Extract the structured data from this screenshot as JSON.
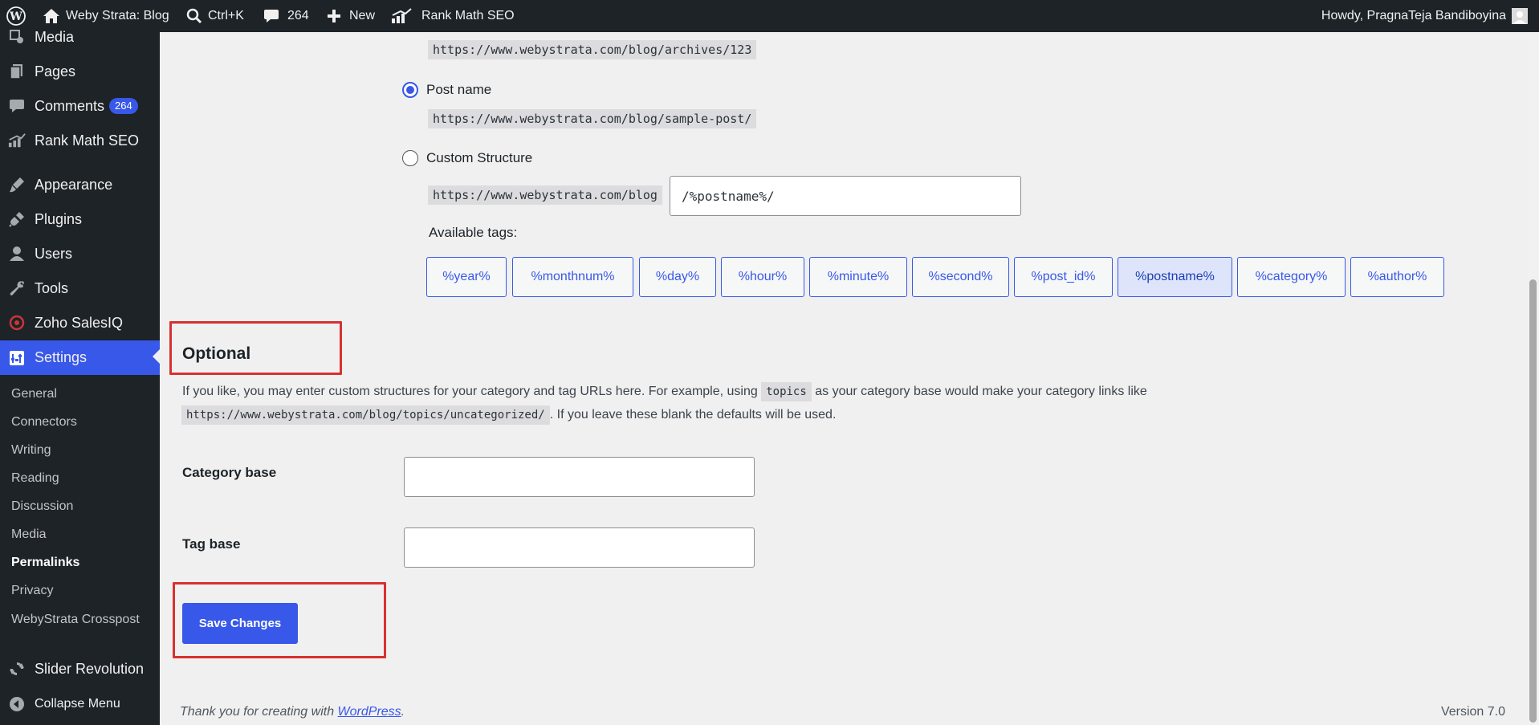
{
  "adminbar": {
    "site_name": "Weby Strata: Blog",
    "search_shortcut": "Ctrl+K",
    "comments_count": "264",
    "new_label": "New",
    "rankmath_label": "Rank Math SEO",
    "howdy": "Howdy, PragnaTeja Bandiboyina"
  },
  "sidebar": {
    "menu": [
      {
        "label": "Media",
        "icon": "media-icon"
      },
      {
        "label": "Pages",
        "icon": "pages-icon"
      },
      {
        "label": "Comments",
        "icon": "comments-icon",
        "badge": "264"
      },
      {
        "label": "Rank Math SEO",
        "icon": "rankmath-icon"
      },
      {
        "label": "Appearance",
        "icon": "appearance-icon"
      },
      {
        "label": "Plugins",
        "icon": "plugins-icon"
      },
      {
        "label": "Users",
        "icon": "users-icon"
      },
      {
        "label": "Tools",
        "icon": "tools-icon"
      },
      {
        "label": "Zoho SalesIQ",
        "icon": "zoho-icon"
      },
      {
        "label": "Settings",
        "icon": "settings-icon"
      }
    ],
    "submenu": [
      "General",
      "Connectors",
      "Writing",
      "Reading",
      "Discussion",
      "Media",
      "Permalinks",
      "Privacy",
      "WebyStrata Crosspost"
    ],
    "bottom": [
      {
        "label": "Slider Revolution",
        "icon": "slider-revolution-icon"
      },
      {
        "label": "Collapse Menu",
        "icon": "collapse-icon"
      }
    ]
  },
  "permalinks": {
    "numeric_example": "https://www.webystrata.com/blog/archives/123",
    "post_name_label": "Post name",
    "post_name_example": "https://www.webystrata.com/blog/sample-post/",
    "custom_label": "Custom Structure",
    "custom_prefix": "https://www.webystrata.com/blog",
    "custom_value": "/%postname%/",
    "available_tags_label": "Available tags:",
    "tags": [
      "%year%",
      "%monthnum%",
      "%day%",
      "%hour%",
      "%minute%",
      "%second%",
      "%post_id%",
      "%postname%",
      "%category%",
      "%author%"
    ],
    "active_tag": "%postname%"
  },
  "optional": {
    "heading": "Optional",
    "desc_1": "If you like, you may enter custom structures for your category and tag URLs here. For example, using",
    "desc_code_1": "topics",
    "desc_2": "as your category base would make your category links like",
    "desc_code_2": "https://www.webystrata.com/blog/topics/uncategorized/",
    "desc_3": ". If you leave these blank the defaults will be used.",
    "category_base_label": "Category base",
    "category_base_value": "",
    "tag_base_label": "Tag base",
    "tag_base_value": ""
  },
  "save_label": "Save Changes",
  "footer": {
    "thanks_prefix": "Thank you for creating with",
    "wp_link": "WordPress",
    "thanks_suffix": ".",
    "version": "Version 7.0"
  },
  "colors": {
    "accent": "#3858e9",
    "highlight": "#d93030",
    "sidebar_bg": "#1d2327"
  }
}
